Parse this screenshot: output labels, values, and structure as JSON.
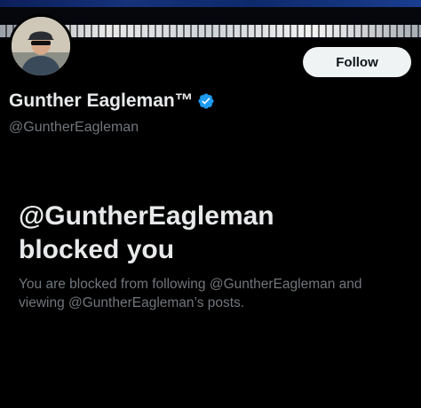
{
  "profile": {
    "display_name": "Gunther Eagleman™",
    "handle": "@GuntherEagleman",
    "verified": true
  },
  "actions": {
    "follow_label": "Follow"
  },
  "blocked": {
    "title_line1": "@GuntherEagleman",
    "title_line2": "blocked you",
    "body": "You are blocked from following @GuntherEagleman and viewing @GuntherEagleman’s posts."
  },
  "colors": {
    "background": "#000000",
    "primary_text": "#e7e9ea",
    "secondary_text": "#71767b",
    "verified_badge": "#1d9bf0",
    "follow_button_bg": "#eff3f4"
  },
  "icons": {
    "verified": "verified-badge-icon"
  }
}
